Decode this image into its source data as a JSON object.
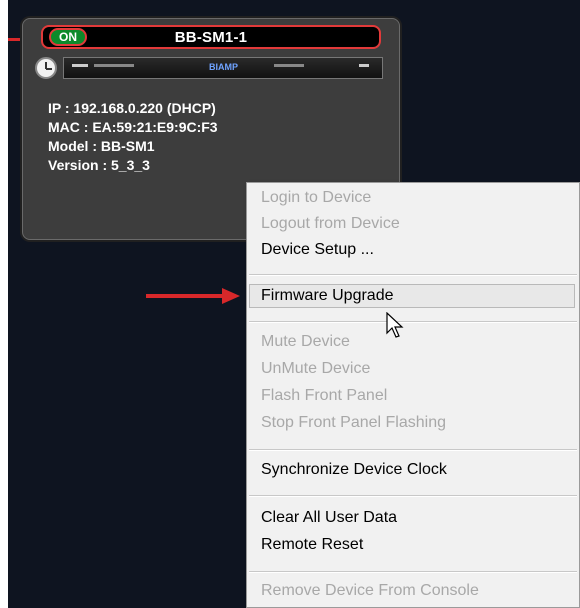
{
  "device": {
    "status": "ON",
    "name": "BB-SM1-1",
    "front_panel_logo": "BIAMP",
    "info": [
      "IP : 192.168.0.220 (DHCP)",
      "MAC : EA:59:21:E9:9C:F3",
      "Model : BB-SM1",
      "Version : 5_3_3"
    ]
  },
  "context_menu": {
    "items": [
      {
        "label": "Login to Device",
        "enabled": false
      },
      {
        "label": "Logout from Device",
        "enabled": false
      },
      {
        "label": "Device Setup ...",
        "enabled": true
      },
      {
        "label": "Firmware Upgrade",
        "enabled": true,
        "highlighted": true
      },
      {
        "label": "Mute Device",
        "enabled": false
      },
      {
        "label": "UnMute Device",
        "enabled": false
      },
      {
        "label": "Flash Front Panel",
        "enabled": false
      },
      {
        "label": "Stop Front Panel Flashing",
        "enabled": false
      },
      {
        "label": "Synchronize Device Clock",
        "enabled": true
      },
      {
        "label": "Clear All User Data",
        "enabled": true
      },
      {
        "label": "Remote Reset",
        "enabled": true
      },
      {
        "label": "Remove Device From Console",
        "enabled": false
      }
    ]
  },
  "colors": {
    "annotation_red": "#d8282a",
    "status_green": "#0c8a2a",
    "background": "#0e1420"
  },
  "icons": {
    "clock": "clock-icon",
    "cursor": "mouse-pointer-icon"
  }
}
